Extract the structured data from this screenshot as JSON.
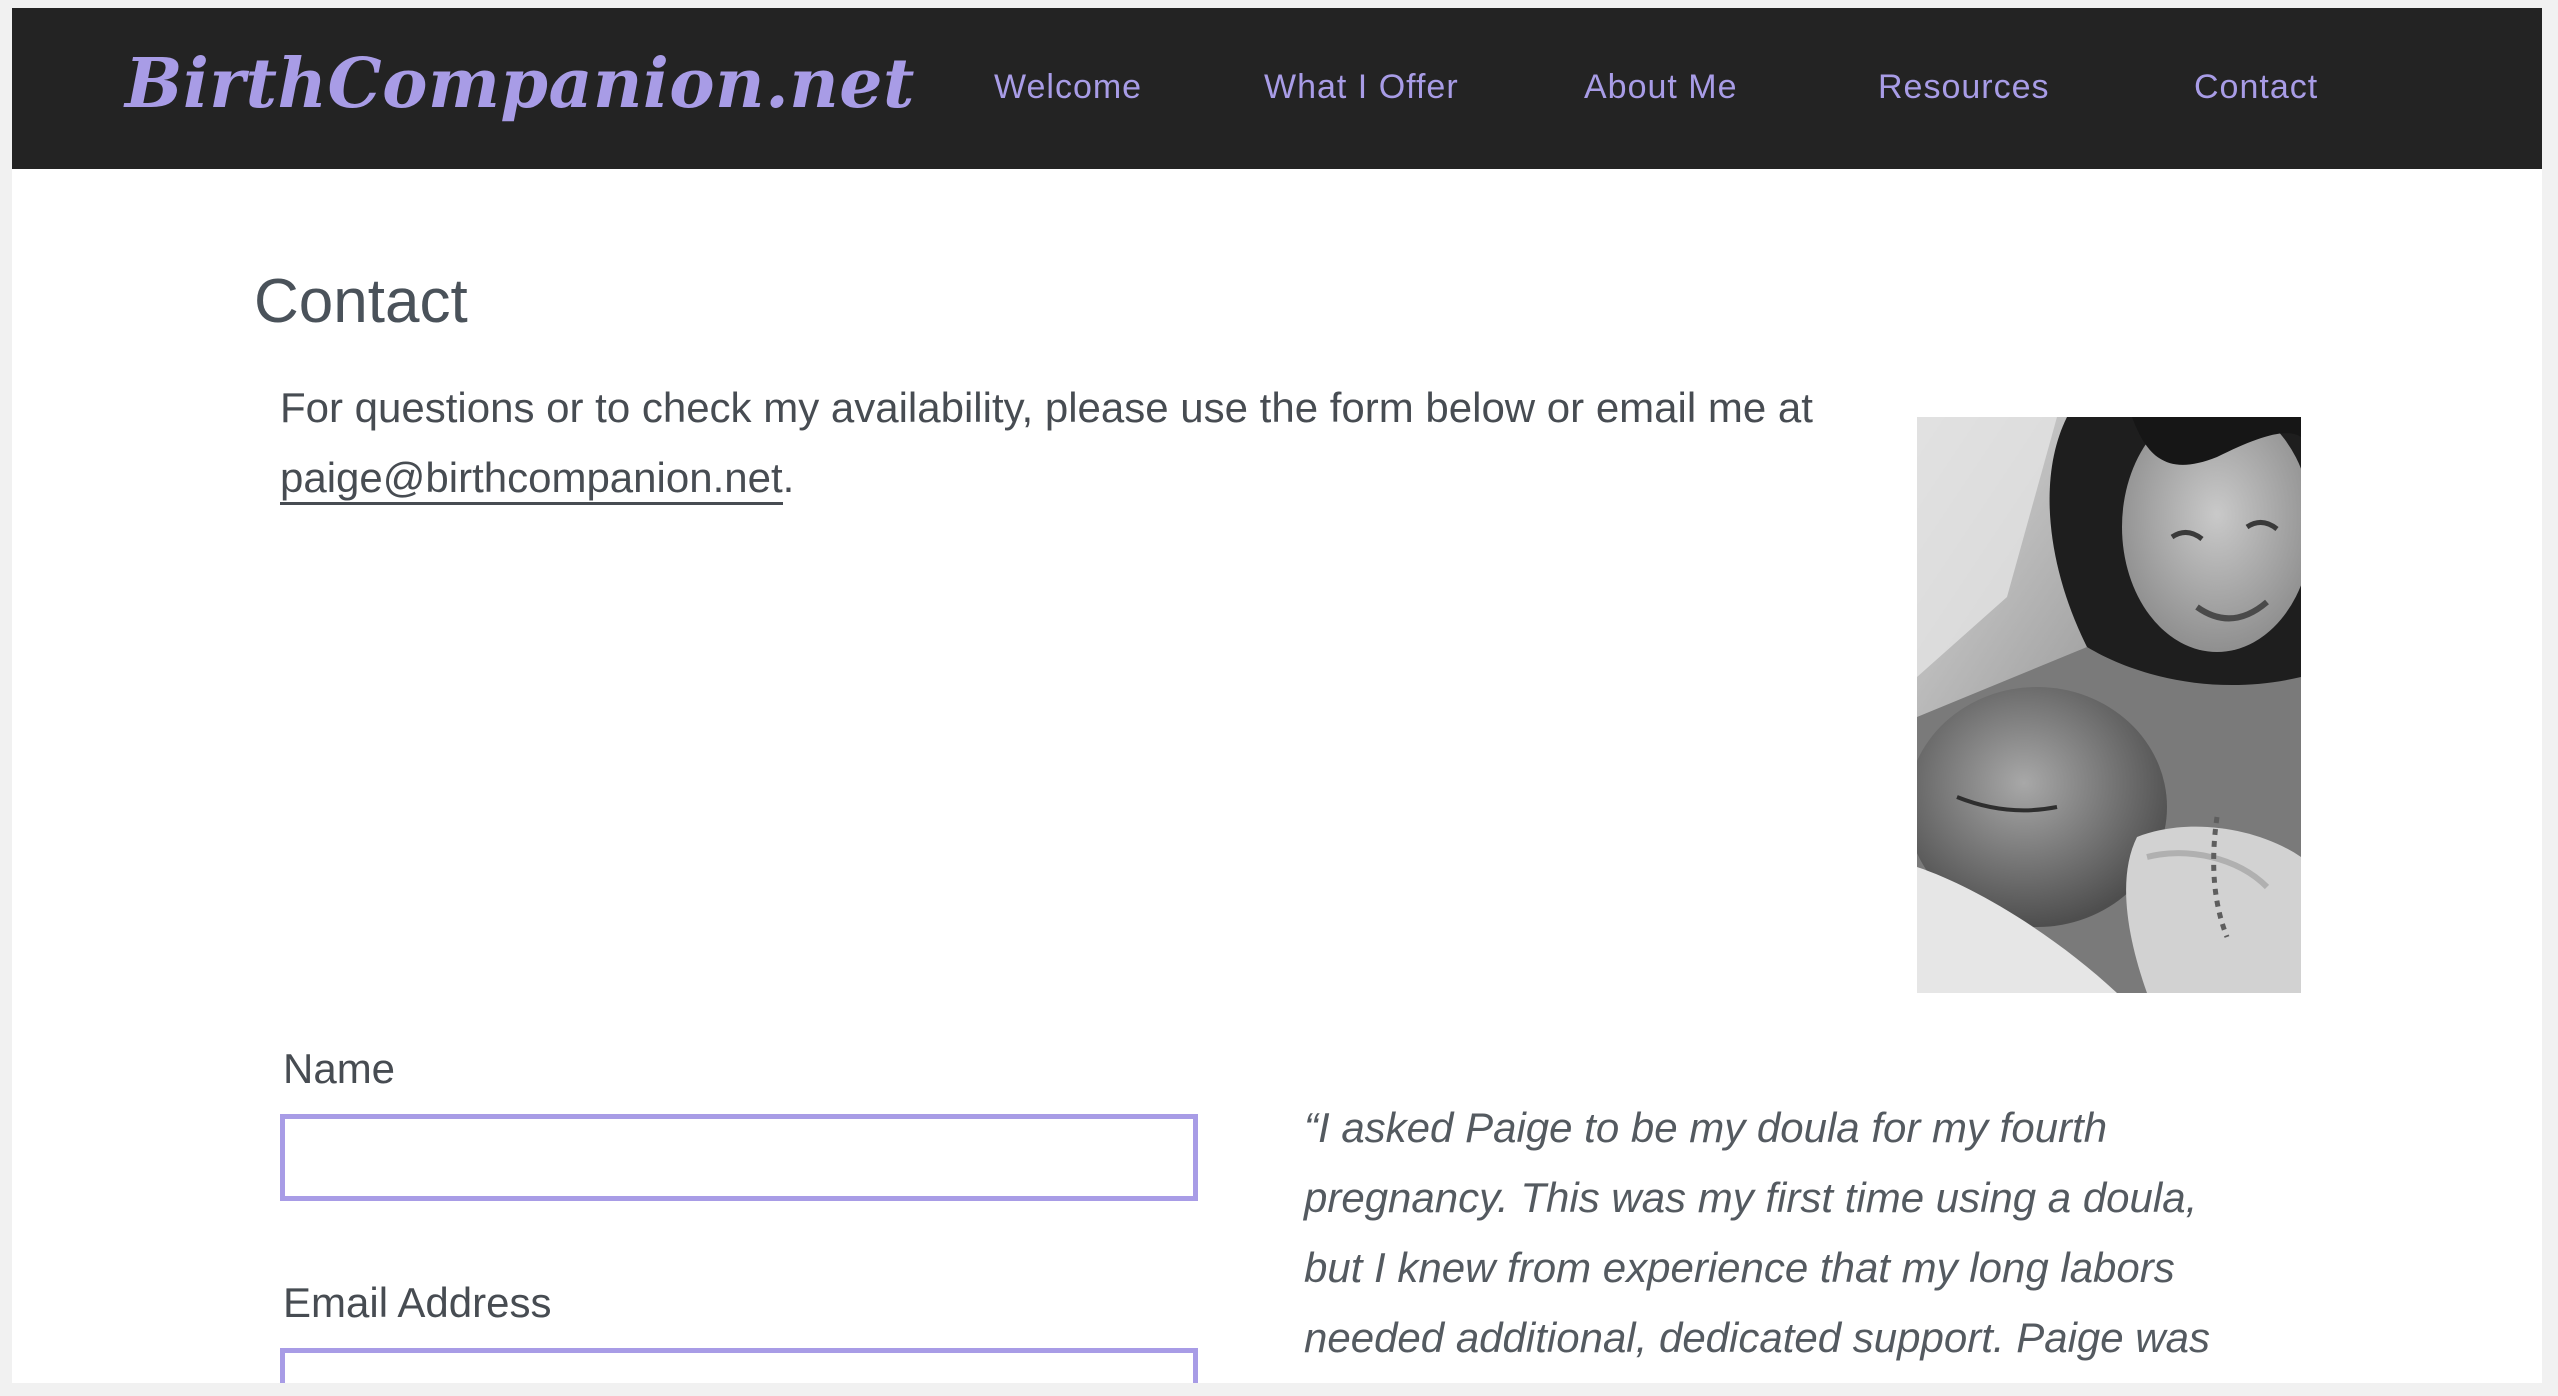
{
  "header": {
    "logo": "BirthCompanion.net",
    "nav": {
      "welcome": "Welcome",
      "what_i_offer": "What I Offer",
      "about_me": "About Me",
      "resources": "Resources",
      "contact": "Contact"
    }
  },
  "main": {
    "title": "Contact",
    "intro_text": "For questions or to check my availability, please use the form below or email me at",
    "email_link": "paige@birthcompanion.net",
    "intro_end": ".",
    "photo_description": "black-and-white photo of a smiling woman holding a newborn baby"
  },
  "form": {
    "name_label": "Name",
    "name_value": "",
    "email_label": "Email Address",
    "email_value": ""
  },
  "testimonial": {
    "lines": [
      "“I asked Paige to be my doula for my fourth",
      "pregnancy. This was my first time using a doula,",
      "but I knew from experience that my long labors",
      "needed additional, dedicated support. Paige was"
    ]
  },
  "colors": {
    "accent": "#a89ce6",
    "header_bg": "#232323",
    "text": "#474c52"
  }
}
